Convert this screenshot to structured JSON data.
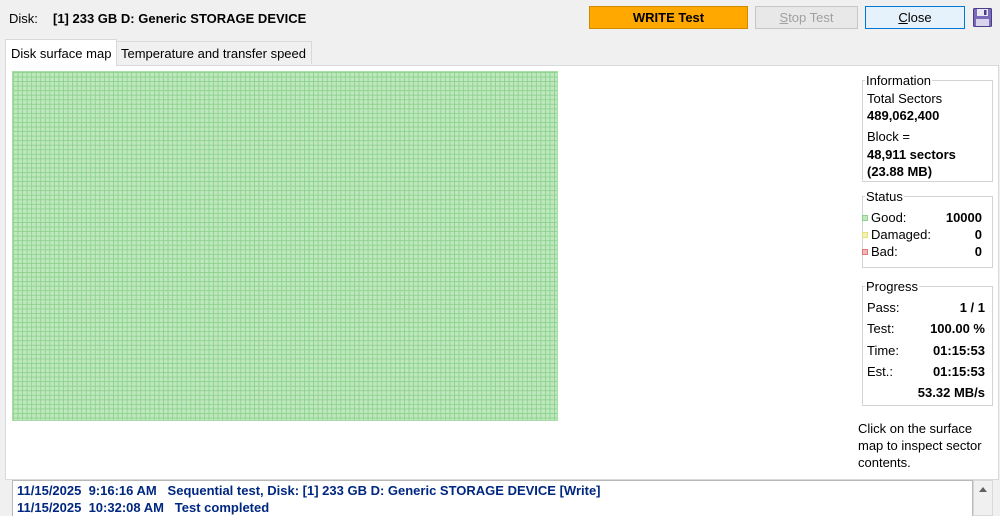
{
  "header": {
    "disk_label": "Disk:",
    "disk_name": "[1] 233 GB D: Generic STORAGE DEVICE",
    "write_button": "WRITE Test",
    "stop_button_u": "S",
    "stop_button_rest": "top Test",
    "close_button_u": "C",
    "close_button_rest": "lose",
    "save_icon": "floppy-disk-icon"
  },
  "tabs": [
    {
      "label": "Disk surface map",
      "active": true
    },
    {
      "label": "Temperature and transfer speed",
      "active": false
    }
  ],
  "surface": {
    "good_color": "#bfe8bf",
    "filled_fraction": 1.0
  },
  "information": {
    "title": "Information",
    "total_sectors_label": "Total Sectors",
    "total_sectors_value": "489,062,400",
    "block_label": "Block =",
    "block_sectors": "48,911 sectors",
    "block_size": "(23.88 MB)"
  },
  "status": {
    "title": "Status",
    "good_label": "Good:",
    "good_value": "10000",
    "good_color": "#8fd28f",
    "damaged_label": "Damaged:",
    "damaged_value": "0",
    "damaged_color": "#e8e07a",
    "bad_label": "Bad:",
    "bad_value": "0",
    "bad_color": "#e07a7a"
  },
  "progress": {
    "title": "Progress",
    "pass_label": "Pass:",
    "pass_value": "1 / 1",
    "test_label": "Test:",
    "test_value": "100.00 %",
    "time_label": "Time:",
    "time_value": "01:15:53",
    "est_label": "Est.:",
    "est_value": "01:15:53",
    "speed": "53.32 MB/s"
  },
  "hint": "Click on the surface map to inspect sector contents.",
  "log": [
    "11/15/2025  9:16:16 AM   Sequential test, Disk: [1] 233 GB D: Generic STORAGE DEVICE [Write]",
    "11/15/2025  10:32:08 AM   Test completed"
  ]
}
